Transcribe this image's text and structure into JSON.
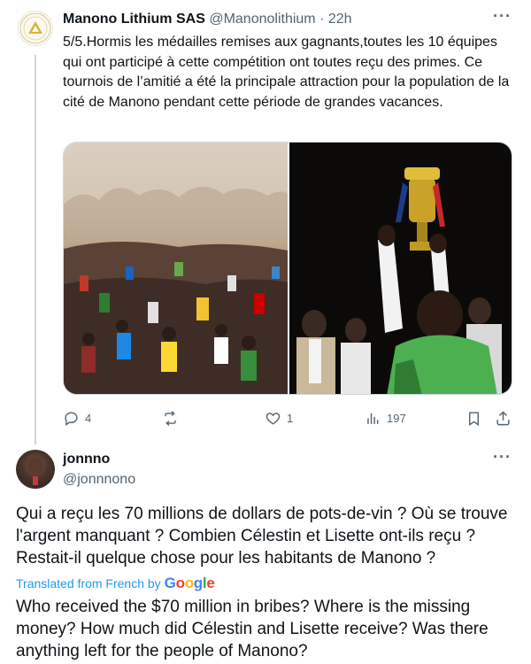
{
  "tweet1": {
    "display_name": "Manono Lithium SAS",
    "handle": "@Manonolithium",
    "separator": "·",
    "time": "22h",
    "text": "5/5.Hormis les médailles remises aux gagnants,toutes les 10 équipes qui ont participé à cette compétition ont toutes reçu des primes. Ce tournois de l’amitié a été la principale attraction pour la population de la cité de Manono pendant cette période de grandes vacances.",
    "media": [
      {
        "icon": "crowd-photo"
      },
      {
        "icon": "trophy-photo"
      }
    ],
    "actions": {
      "replies": "4",
      "reposts": "",
      "likes": "1",
      "views": "197"
    }
  },
  "tweet2": {
    "display_name": "jonnno",
    "handle": "@jonnnono",
    "text": "Qui a reçu les 70 millions de dollars de pots-de-vin ? Où se trouve l'argent manquant ? Combien Célestin et Lisette ont-ils reçu ? Restait-il quelque chose pour les habitants de Manono ?",
    "translated_label": "Translated from French by",
    "translator": "Google",
    "translation": "Who received the $70 million in bribes? Where is the missing money? How much did Célestin and Lisette receive? Was there anything left for the people of Manono?"
  },
  "colors": {
    "text": "#0f1419",
    "muted": "#536471",
    "link": "#1d9bf0",
    "border": "#cfd9de"
  }
}
